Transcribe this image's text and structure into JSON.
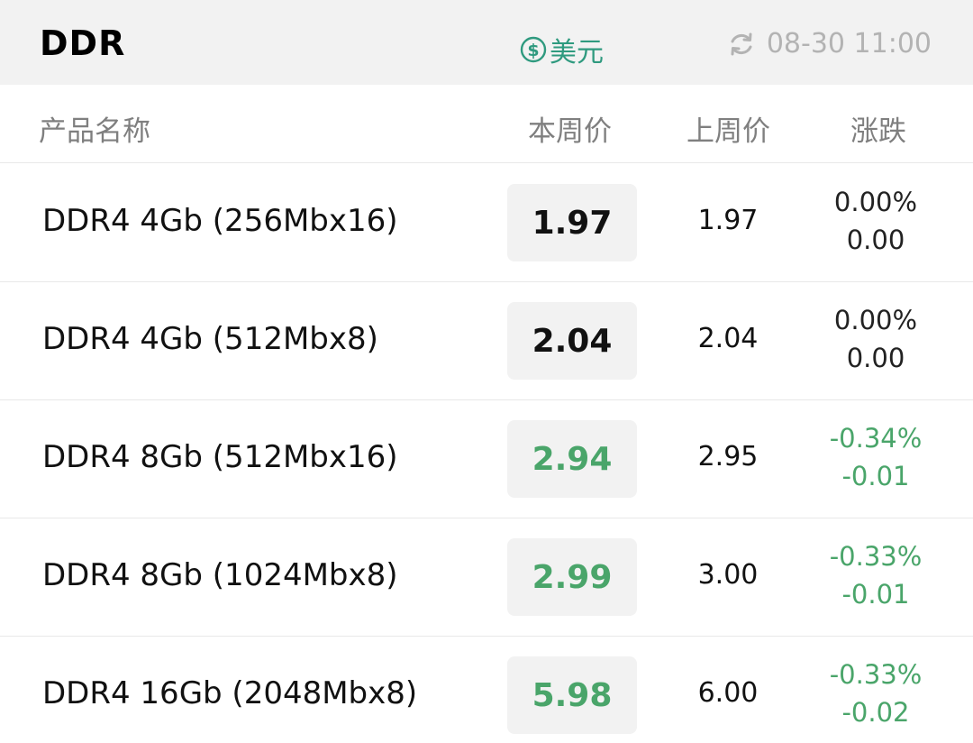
{
  "header": {
    "title": "DDR",
    "currency_label": "美元",
    "updated_time": "08-30 11:00",
    "currency_icon": "dollar-circle-icon",
    "refresh_icon": "refresh-icon",
    "currency_color": "#2f9a7f"
  },
  "columns": {
    "name": "产品名称",
    "this_week": "本周价",
    "last_week": "上周价",
    "change": "涨跌"
  },
  "colors": {
    "down": "#4aa56a",
    "neutral": "#111111"
  },
  "rows": [
    {
      "name": "DDR4 4Gb (256Mbx16)",
      "this_week": "1.97",
      "last_week": "1.97",
      "change_pct": "0.00%",
      "change_abs": "0.00",
      "trend": "flat"
    },
    {
      "name": "DDR4 4Gb (512Mbx8)",
      "this_week": "2.04",
      "last_week": "2.04",
      "change_pct": "0.00%",
      "change_abs": "0.00",
      "trend": "flat"
    },
    {
      "name": "DDR4 8Gb (512Mbx16)",
      "this_week": "2.94",
      "last_week": "2.95",
      "change_pct": "-0.34%",
      "change_abs": "-0.01",
      "trend": "down"
    },
    {
      "name": "DDR4 8Gb (1024Mbx8)",
      "this_week": "2.99",
      "last_week": "3.00",
      "change_pct": "-0.33%",
      "change_abs": "-0.01",
      "trend": "down"
    },
    {
      "name": "DDR4 16Gb (2048Mbx8)",
      "this_week": "5.98",
      "last_week": "6.00",
      "change_pct": "-0.33%",
      "change_abs": "-0.02",
      "trend": "down"
    }
  ]
}
